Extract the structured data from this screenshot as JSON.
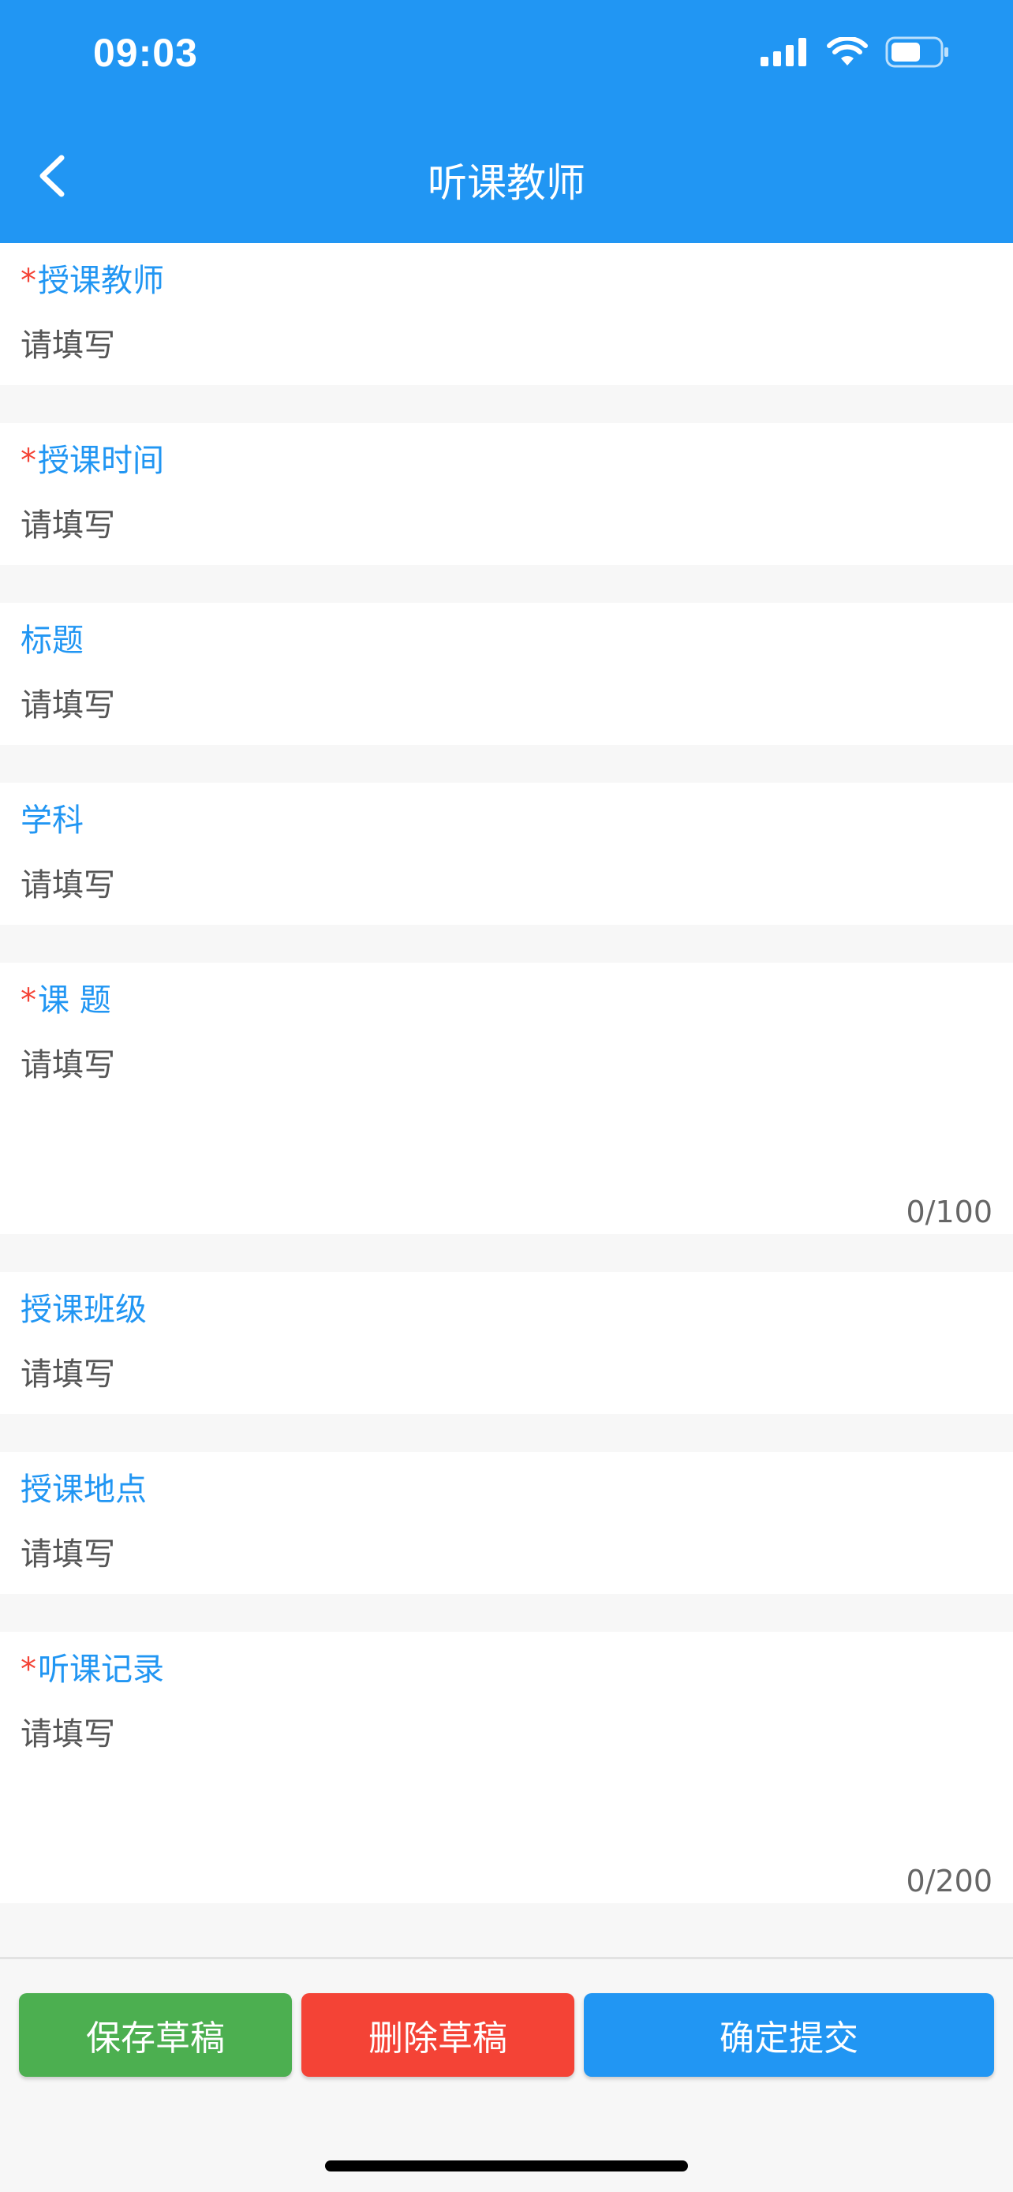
{
  "status_bar": {
    "time": "09:03"
  },
  "nav": {
    "title": "听课教师"
  },
  "form": {
    "required_mark": "*",
    "placeholder": "请填写",
    "fields": [
      {
        "label": "授课教师",
        "required": true
      },
      {
        "label": "授课时间",
        "required": true
      },
      {
        "label": "标题",
        "required": false
      },
      {
        "label": "学科",
        "required": false
      },
      {
        "label": "课 题",
        "required": true,
        "counter": "0/100"
      },
      {
        "label": "授课班级",
        "required": false
      },
      {
        "label": "授课地点",
        "required": false
      },
      {
        "label": "听课记录",
        "required": true,
        "counter": "0/200"
      }
    ]
  },
  "actions": {
    "save_draft": "保存草稿",
    "delete_draft": "删除草稿",
    "submit": "确定提交"
  },
  "colors": {
    "primary": "#2196f3",
    "save": "#4caf50",
    "delete": "#f44336",
    "required": "#f44336"
  },
  "icons": {
    "back": "chevron-left-icon",
    "signal": "cellular-signal-icon",
    "wifi": "wifi-icon",
    "battery": "battery-icon"
  }
}
